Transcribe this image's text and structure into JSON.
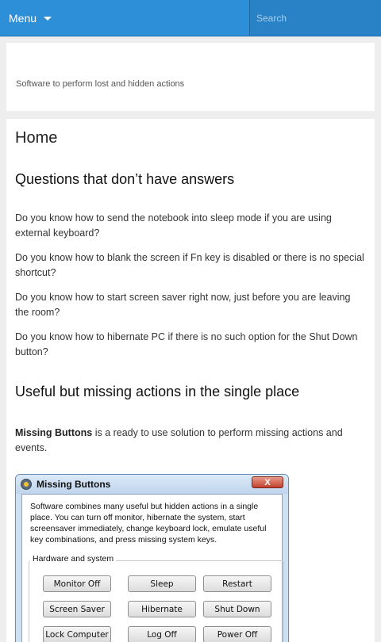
{
  "topbar": {
    "menu_label": "Menu",
    "search_placeholder": "Search"
  },
  "site": {
    "tagline": "Software to perform lost and hidden actions"
  },
  "page": {
    "title": "Home",
    "section1_heading": "Questions that don’t have answers",
    "questions": [
      "Do you know how to send the notebook into sleep mode if you are using external keyboard?",
      "Do you know how to blank the screen if Fn key is disabled or there is no special shortcut?",
      "Do you know how to start screen saver right now, just before you are leaving the room?",
      "Do you know how to hibernate PC if there is no such option for the Shut Down button?"
    ],
    "section2_heading": "Useful but missing actions in the single place",
    "intro_bold": "Missing Buttons",
    "intro_rest": " is a ready to use solution to perform missing actions and events."
  },
  "app_window": {
    "title": "Missing Buttons",
    "close_label": "X",
    "description": "Software combines many useful but hidden actions in a single place. You can turn off monitor, hibernate the system, start screensaver immediately, change keyboard lock, emulate useful key combinations, and press missing system keys.",
    "group_label": "Hardware and system",
    "buttons": [
      "Monitor Off",
      "Sleep",
      "Restart",
      "Screen Saver",
      "Hibernate",
      "Shut Down",
      "Lock Computer",
      "Log Off",
      "Power Off"
    ]
  }
}
